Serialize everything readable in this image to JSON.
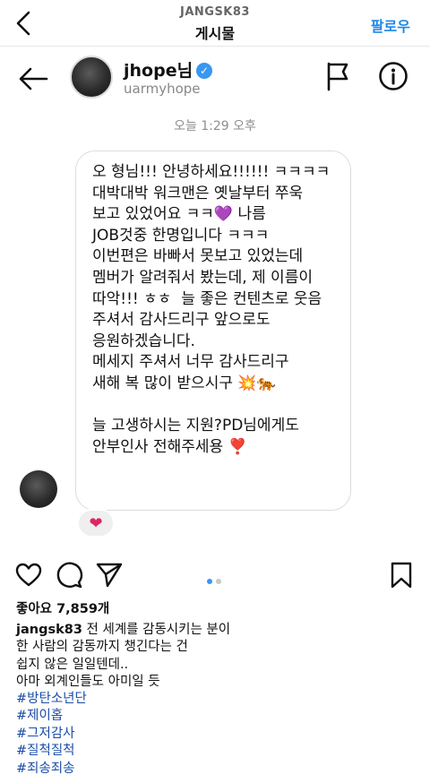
{
  "topbar": {
    "account": "JANGSK83",
    "title": "게시물",
    "follow_label": "팔로우"
  },
  "dm": {
    "name": "jhope님",
    "handle": "uarmyhope",
    "timestamp": "오늘 1:29 오후",
    "message": "오 형님!!! 안녕하세요!!!!!! ㅋㅋㅋㅋ\n대박대박 워크맨은 옛날부터 쭈욱\n보고 있었어요 ㅋㅋ💜 나름\nJOB것중 한명입니다 ㅋㅋㅋ\n이번편은 바빠서 못보고 있었는데\n멤버가 알려줘서 봤는데, 제 이름이\n따악!!! ㅎㅎ  늘 좋은 컨텐츠로 웃음\n주셔서 감사드리구 앞으로도\n응원하겠습니다.\n메세지 주셔서 너무 감사드리구\n새해 복 많이 받으시구 💥🐅\n\n늘 고생하시는 지원?PD님에게도\n안부인사 전해주세용 ❣️",
    "reaction": "❤"
  },
  "post": {
    "likes": "좋아요 7,859개",
    "caption_user": "jangsk83",
    "caption_lines": [
      "전 세계를 감동시키는 분이",
      "한 사람의 감동까지 챙긴다는 건",
      "쉽지 않은 일일텐데..",
      "아마 외계인들도 아미일 듯"
    ],
    "hashtags": [
      "#방탄소년단",
      "#제이홉",
      "#그저감사",
      "#질척질척",
      "#죄송죄송"
    ],
    "carousel_active": 1,
    "carousel_count": 2
  },
  "icons": {
    "back": "chevron-left-icon",
    "dm_back": "arrow-left-icon",
    "flag": "flag-icon",
    "info": "info-icon",
    "like": "heart-icon",
    "comment": "comment-icon",
    "share": "send-icon",
    "save": "bookmark-icon"
  },
  "colors": {
    "accent": "#1e88e5",
    "hashtag": "#1c4ea7",
    "verified": "#3897f0",
    "reaction_heart": "#e0245e"
  }
}
